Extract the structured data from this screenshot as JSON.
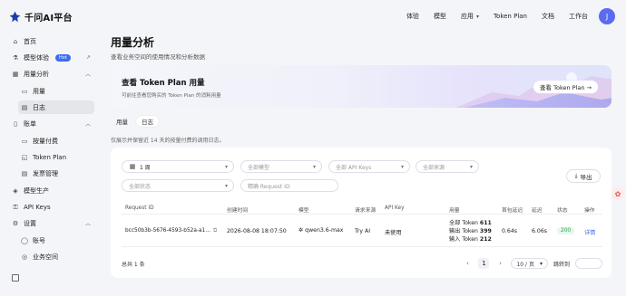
{
  "brand": {
    "name": "千问AI平台"
  },
  "topnav": {
    "items": [
      {
        "label": "体验"
      },
      {
        "label": "模型"
      },
      {
        "label": "应用"
      },
      {
        "label": "Token Plan"
      },
      {
        "label": "文档"
      },
      {
        "label": "工作台"
      }
    ],
    "avatar": "J"
  },
  "sidebar": {
    "items": [
      {
        "label": "首页",
        "icon": "home-icon"
      },
      {
        "label": "模型体验",
        "badge": "Hot",
        "icon": "flask-icon"
      },
      {
        "label": "用量分析",
        "icon": "chart-icon"
      },
      {
        "label": "用量",
        "icon": "bar-icon"
      },
      {
        "label": "日志",
        "icon": "doc-icon"
      },
      {
        "label": "账单",
        "icon": "bill-icon"
      },
      {
        "label": "按量付费",
        "icon": "card-icon"
      },
      {
        "label": "Token Plan",
        "icon": "plan-icon"
      },
      {
        "label": "发票管理",
        "icon": "invoice-icon"
      },
      {
        "label": "模型生产",
        "icon": "cube-icon"
      },
      {
        "label": "API Keys",
        "icon": "key-icon"
      },
      {
        "label": "设置",
        "icon": "gear-icon"
      },
      {
        "label": "账号",
        "icon": "user-icon"
      },
      {
        "label": "业务空间",
        "icon": "space-icon"
      }
    ]
  },
  "page": {
    "title": "用量分析",
    "subtitle": "查看业务空间的使用情况和分析数据"
  },
  "banner": {
    "title": "查看 Token Plan 用量",
    "desc": "可前往查看您购买的 Token Plan 的消耗用量",
    "button": "查看 Token Plan →"
  },
  "tabs": [
    {
      "label": "用量"
    },
    {
      "label": "日志"
    }
  ],
  "retain_note": "仅展示并保留近 14 天的按量付费的调用日志。",
  "filters": {
    "time": "1 周",
    "model_placeholder": "全部模型",
    "apikey_placeholder": "全部 API Keys",
    "source_placeholder": "全部来源",
    "status_placeholder": "全部状态",
    "request_placeholder": "精确 Request ID",
    "export": "导出"
  },
  "table": {
    "headers": [
      "Request ID",
      "创建时间",
      "模型",
      "请求来源",
      "API Key",
      "用量",
      "首包延迟",
      "延迟",
      "状态",
      "操作"
    ],
    "rows": [
      {
        "request_id": "bcc50b3b-5676-4593-b52a-a1…",
        "created": "2026-08-08 18:07:50",
        "model": "qwen3.6-max",
        "source": "Try AI",
        "api_key": "未使用",
        "tokens": [
          {
            "label": "全部 Token",
            "value": "611"
          },
          {
            "label": "输出 Token",
            "value": "399"
          },
          {
            "label": "输入 Token",
            "value": "212"
          }
        ],
        "first_latency": "0.64s",
        "latency": "6.06s",
        "status": "200",
        "action": "详情"
      }
    ]
  },
  "pagination": {
    "total": "总共 1 条",
    "current": "1",
    "page_size": "10 / 页",
    "jump_label": "跳转到"
  }
}
